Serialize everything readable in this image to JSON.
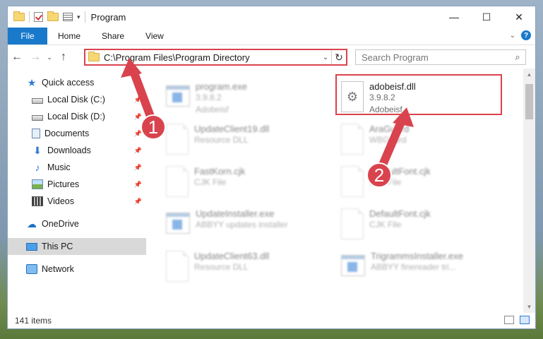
{
  "window": {
    "title": "Program",
    "minimize": "—",
    "maximize": "☐",
    "close": "✕"
  },
  "ribbon": {
    "tabs": [
      "File",
      "Home",
      "Share",
      "View"
    ]
  },
  "nav": {
    "address_path": "C:\\Program Files\\Program Directory",
    "search_placeholder": "Search Program"
  },
  "sidebar": {
    "quick_access": "Quick access",
    "items": [
      "Local Disk (C:)",
      "Local Disk (D:)",
      "Documents",
      "Downloads",
      "Music",
      "Pictures",
      "Videos"
    ],
    "onedrive": "OneDrive",
    "this_pc": "This PC",
    "network": "Network"
  },
  "files": [
    {
      "name": "program.exe",
      "line2": "3.9.8.2",
      "line3": "Adobeisf"
    },
    {
      "name": "adobeisf.dll",
      "line2": "3.9.8.2",
      "line3": "Adobeisf"
    },
    {
      "name": "UpdateClient19.dll",
      "line2": "Resource DLL",
      "line3": ""
    },
    {
      "name": "AraGuard",
      "line2": "WBGuard",
      "line3": ""
    },
    {
      "name": "FastKorn.cjk",
      "line2": "CJK File",
      "line3": ""
    },
    {
      "name": "DefaultFont.cjk",
      "line2": "CJK File",
      "line3": ""
    },
    {
      "name": "UpdateInstaller.exe",
      "line2": "ABBYY updates installer",
      "line3": ""
    },
    {
      "name": "DefaultFont.cjk",
      "line2": "CJK File",
      "line3": ""
    },
    {
      "name": "UpdateClient63.dll",
      "line2": "Resource DLL",
      "line3": ""
    },
    {
      "name": "TrigrammsInstaller.exe",
      "line2": "ABBYY finereader tri...",
      "line3": ""
    }
  ],
  "annotations": {
    "step1": "1",
    "step2": "2"
  },
  "status": {
    "item_count": "141 items"
  },
  "colors": {
    "accent": "#1979ca",
    "highlight": "#d9434d"
  }
}
